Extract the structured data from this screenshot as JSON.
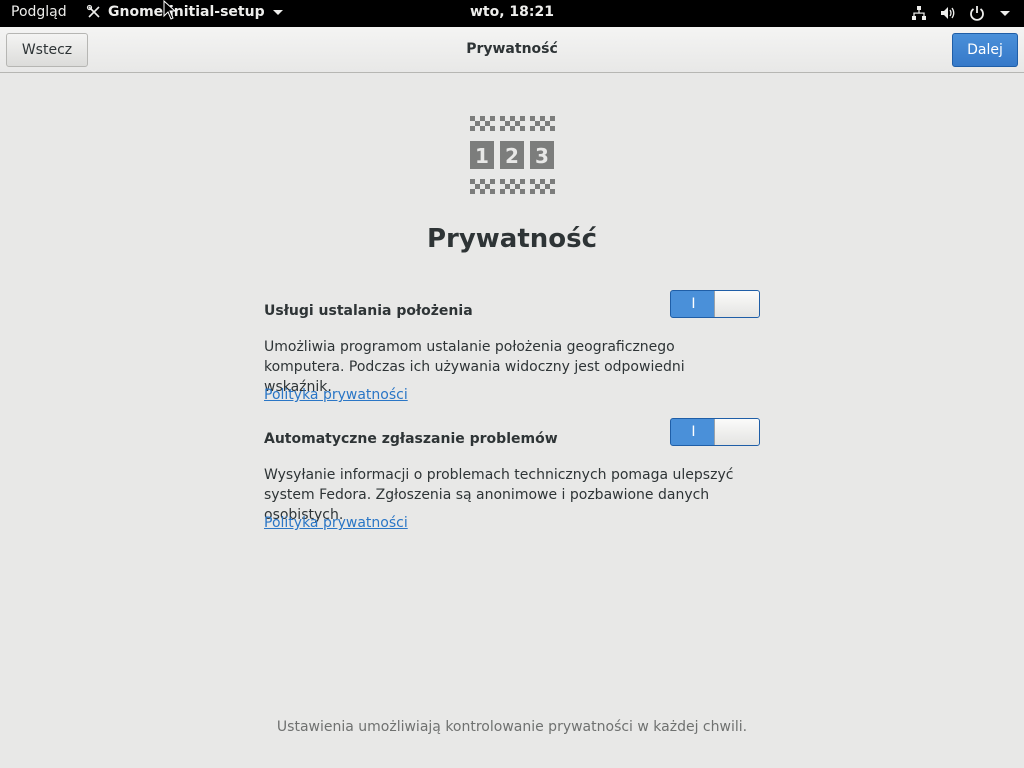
{
  "topbar": {
    "activities_label": "Podgląd",
    "app_name": "Gnome-initial-setup",
    "clock": "wto, 18:21",
    "icons": [
      "network-wired-icon",
      "volume-icon",
      "power-icon",
      "chevron-down-icon"
    ]
  },
  "header": {
    "back_label": "Wstecz",
    "title": "Prywatność",
    "next_label": "Dalej"
  },
  "main": {
    "logo_digits": [
      "1",
      "2",
      "3"
    ],
    "heading": "Prywatność",
    "sections": [
      {
        "title": "Usługi ustalania położenia",
        "toggle_on_label": "I",
        "toggle_state": "on",
        "description": "Umożliwia programom ustalanie położenia geograficznego komputera. Podczas ich używania widoczny jest odpowiedni wskaźnik.",
        "link": "Polityka prywatności"
      },
      {
        "title": "Automatyczne zgłaszanie problemów",
        "toggle_on_label": "I",
        "toggle_state": "on",
        "description": "Wysyłanie informacji o problemach technicznych pomaga ulepszyć system Fedora. Zgłoszenia są anonimowe i pozbawione danych osobistych.",
        "link": "Polityka prywatności"
      }
    ],
    "footer_note": "Ustawienia umożliwiają kontrolowanie prywatności w każdej chwili."
  },
  "colors": {
    "accent": "#4a90d9",
    "link": "#2a76c6",
    "background": "#e8e8e7",
    "topbar": "#000000"
  }
}
